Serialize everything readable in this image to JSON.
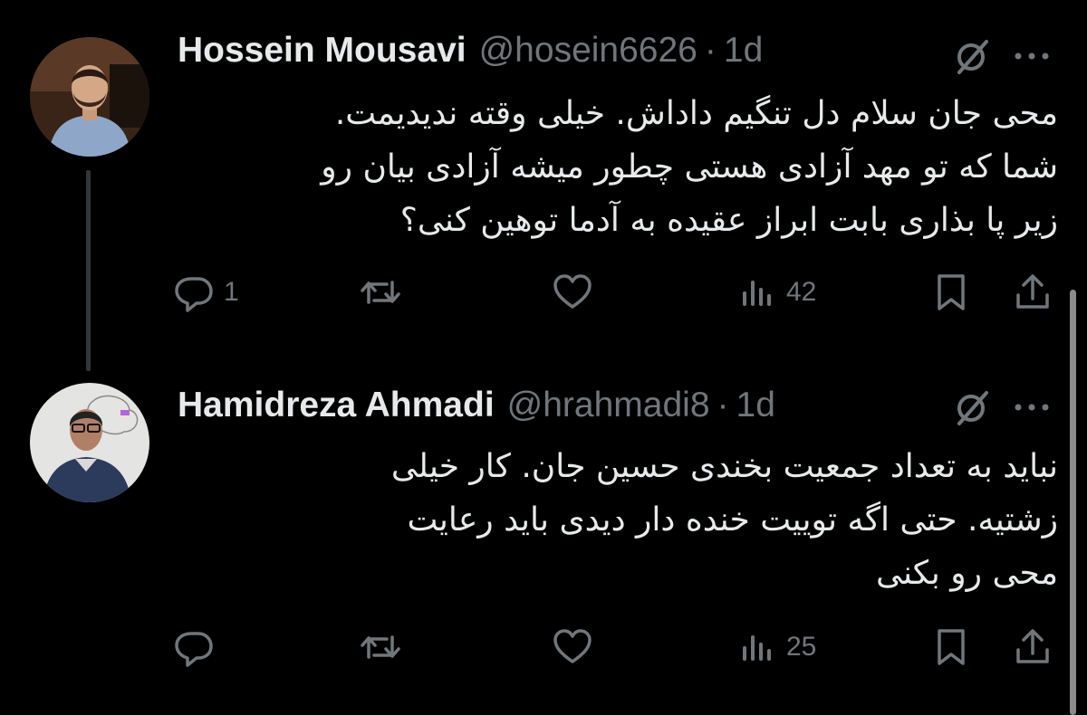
{
  "tweets": [
    {
      "author_name": "Hossein Mousavi",
      "handle": "@hosein6626",
      "separator": "·",
      "time": "1d",
      "lines": [
        "محی جان سلام دل تنگیم داداش. خیلی وقته ندیدیمت.",
        "شما که تو مهد آزادی هستی چطور میشه آزادی بیان رو",
        "زیر پا بذاری بابت ابراز عقیده به آدما توهین کنی؟"
      ],
      "actions": {
        "reply_count": "1",
        "retweet_count": "",
        "like_count": "",
        "views_count": "42"
      }
    },
    {
      "author_name": "Hamidreza Ahmadi",
      "handle": "@hrahmadi8",
      "separator": "·",
      "time": "1d",
      "lines": [
        "نباید به تعداد جمعیت بخندی حسین جان. کار خیلی",
        "زشتیه. حتی اگه توییت خنده دار دیدی باید رعایت",
        "محی رو بکنی"
      ],
      "actions": {
        "reply_count": "",
        "retweet_count": "",
        "like_count": "",
        "views_count": "25"
      }
    }
  ],
  "icons": {
    "reply": "reply-icon",
    "retweet": "retweet-icon",
    "like": "heart-icon",
    "views": "views-icon",
    "bookmark": "bookmark-icon",
    "share": "share-icon",
    "grok": "grok-icon",
    "more": "more-icon"
  },
  "colors": {
    "background": "#000000",
    "text": "#e7e9ea",
    "secondary": "#71767b"
  }
}
